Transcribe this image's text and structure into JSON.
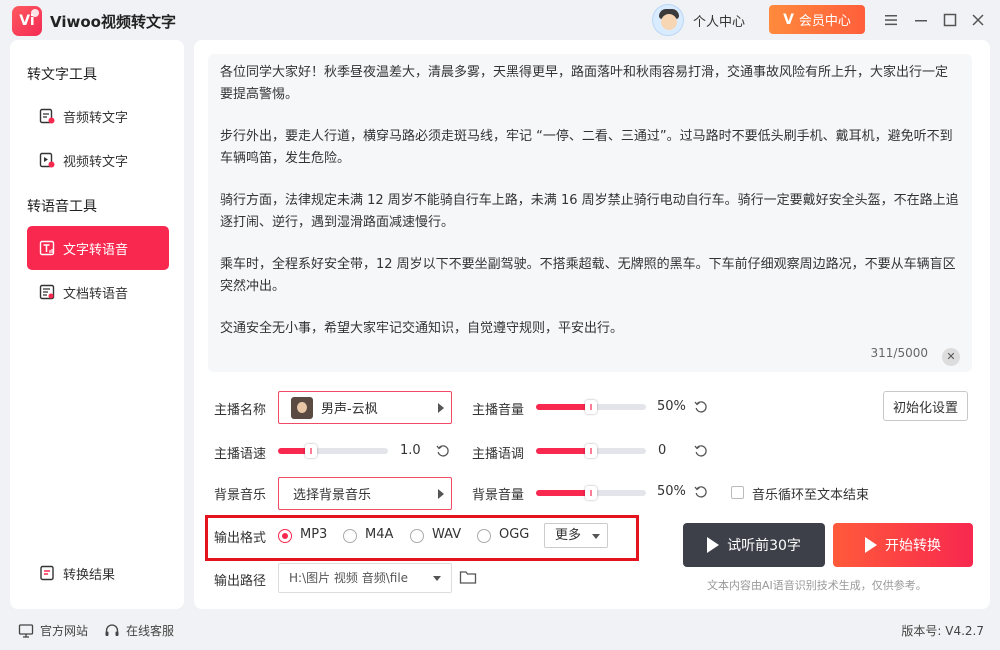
{
  "app": {
    "title": "Viwoo视频转文字",
    "logo_text": "Vi"
  },
  "header": {
    "user_center": "个人中心",
    "vip_label": "会员中心",
    "vip_icon": "V"
  },
  "window_controls": {
    "minimize": "—",
    "restore": "☐",
    "maximize": "☐",
    "close": "✕"
  },
  "sidebar": {
    "group1": "转文字工具",
    "items1": [
      {
        "label": "音频转文字",
        "icon": "audio-to-text-icon"
      },
      {
        "label": "视频转文字",
        "icon": "video-to-text-icon"
      }
    ],
    "group2": "转语音工具",
    "items2": [
      {
        "label": "文字转语音",
        "icon": "text-to-speech-icon",
        "active": true
      },
      {
        "label": "文档转语音",
        "icon": "doc-to-speech-icon"
      }
    ],
    "result": {
      "label": "转换结果",
      "icon": "result-icon"
    }
  },
  "editor": {
    "paragraphs": [
      "各位同学大家好！秋季昼夜温差大，清晨多雾，天黑得更早，路面落叶和秋雨容易打滑，交通事故风险有所上升，大家出行一定要提高警惕。",
      "步行外出，要走人行道，横穿马路必须走斑马线，牢记 “一停、二看、三通过”。过马路时不要低头刷手机、戴耳机，避免听不到车辆鸣笛，发生危险。",
      "骑行方面，法律规定未满 12 周岁不能骑自行车上路，未满 16 周岁禁止骑行电动自行车。骑行一定要戴好安全头盔，不在路上追逐打闹、逆行，遇到湿滑路面减速慢行。",
      "乘车时，全程系好安全带，12 周岁以下不要坐副驾驶。不搭乘超载、无牌照的黑车。下车前仔细观察周边路况，不要从车辆盲区突然冲出。",
      "交通安全无小事，希望大家牢记交通知识，自觉遵守规则，平安出行。"
    ],
    "char_count": "311/5000",
    "clear": "✕"
  },
  "settings": {
    "anchor_label": "主播名称",
    "anchor_value": "男声-云枫",
    "volume_label": "主播音量",
    "volume_value": "50%",
    "volume_fraction": 0.5,
    "speed_label": "主播语速",
    "speed_value": "1.0",
    "speed_fraction": 0.3,
    "pitch_label": "主播语调",
    "pitch_value": "0",
    "pitch_fraction": 0.5,
    "bgm_label": "背景音乐",
    "bgm_value": "选择背景音乐",
    "bgm_volume_label": "背景音量",
    "bgm_volume_value": "50%",
    "bgm_volume_fraction": 0.5,
    "init_button": "初始化设置",
    "loop_label": "音乐循环至文本结束",
    "loop_checked": false
  },
  "output": {
    "format_label": "输出格式",
    "formats": [
      {
        "label": "MP3",
        "selected": true
      },
      {
        "label": "M4A",
        "selected": false
      },
      {
        "label": "WAV",
        "selected": false
      },
      {
        "label": "OGG",
        "selected": false
      }
    ],
    "more": "更多",
    "path_label": "输出路径",
    "path_value": "H:\\图片 视频 音频\\file"
  },
  "actions": {
    "preview": "试听前30字",
    "start": "开始转换",
    "disclaimer": "文本内容由AI语音识别技术生成，仅供参考。"
  },
  "status": {
    "website": "官方网站",
    "support": "在线客服",
    "version": "版本号:  V4.2.7"
  },
  "colors": {
    "accent": "#f8284f",
    "vip": "#ff6a3b",
    "dark_button": "#3d4048",
    "highlight": "#e3141e"
  }
}
